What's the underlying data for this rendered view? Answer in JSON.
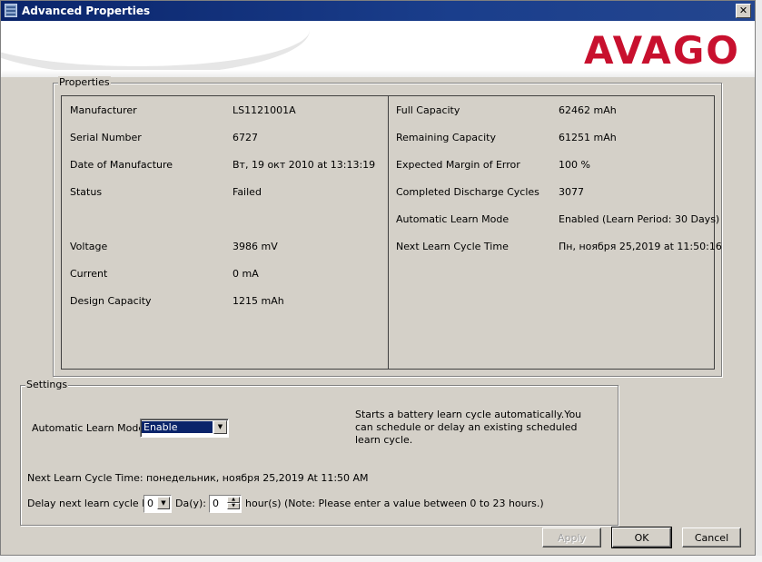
{
  "window": {
    "title": "Advanced Properties",
    "close_label": "✕"
  },
  "banner": {
    "logo": "AVAGO"
  },
  "properties": {
    "legend": "Properties",
    "left": [
      {
        "label": "Manufacturer",
        "value": "LS1121001A"
      },
      {
        "label": "Serial Number",
        "value": "6727"
      },
      {
        "label": "Date of Manufacture",
        "value": "Вт, 19 окт 2010 at 13:13:19"
      },
      {
        "label": "Status",
        "value": "Failed"
      },
      {
        "label": "Voltage",
        "value": "3986 mV"
      },
      {
        "label": "Current",
        "value": "0 mA"
      },
      {
        "label": "Design Capacity",
        "value": "1215 mAh"
      }
    ],
    "right": [
      {
        "label": "Full Capacity",
        "value": "62462 mAh"
      },
      {
        "label": "Remaining Capacity",
        "value": "61251 mAh"
      },
      {
        "label": "Expected Margin of Error",
        "value": "100 %"
      },
      {
        "label": "Completed Discharge Cycles",
        "value": "3077"
      },
      {
        "label": "Automatic Learn Mode",
        "value": "Enabled (Learn Period: 30 Days)"
      },
      {
        "label": "Next Learn Cycle Time",
        "value": "Пн, ноября 25,2019 at 11:50:16"
      }
    ]
  },
  "settings": {
    "legend": "Settings",
    "learn_mode_label": "Automatic Learn Mode:",
    "learn_mode_value": "Enable",
    "help_line1": "Starts a battery learn cycle automatically.You",
    "help_line2": "can schedule or delay an existing scheduled",
    "help_line3": "learn cycle.",
    "next_cycle_text": "Next Learn Cycle Time: понедельник, ноября 25,2019 At 11:50 AM",
    "delay_label": "Delay next learn cycle by",
    "days_value": "0",
    "days_label": "Da(y):",
    "hours_value": "0",
    "hours_label": "hour(s) (Note: Please enter a value between 0 to 23 hours.)"
  },
  "buttons": {
    "apply": "Apply",
    "ok": "OK",
    "cancel": "Cancel"
  }
}
